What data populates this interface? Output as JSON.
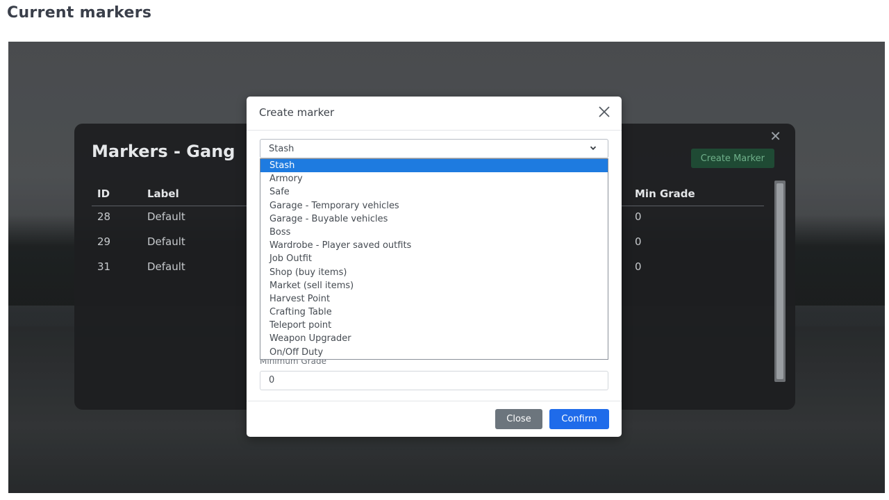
{
  "page": {
    "heading": "Current markers"
  },
  "panel": {
    "title": "Markers - Gang",
    "create_button": "Create Marker",
    "columns": {
      "id": "ID",
      "label": "Label",
      "min_grade": "Min Grade"
    },
    "rows": [
      {
        "id": "28",
        "label": "Default",
        "min_grade": "0"
      },
      {
        "id": "29",
        "label": "Default",
        "min_grade": "0"
      },
      {
        "id": "31",
        "label": "Default",
        "min_grade": "0"
      }
    ]
  },
  "modal": {
    "title": "Create marker",
    "select": {
      "value": "Stash",
      "options": [
        "Stash",
        "Armory",
        "Safe",
        "Garage - Temporary vehicles",
        "Garage - Buyable vehicles",
        "Boss",
        "Wardrobe - Player saved outfits",
        "Job Outfit",
        "Shop (buy items)",
        "Market (sell items)",
        "Harvest Point",
        "Crafting Table",
        "Teleport point",
        "Weapon Upgrader",
        "On/Off Duty"
      ]
    },
    "min_grade_label": "Minimum Grade",
    "min_grade_value": "0",
    "close_button": "Close",
    "confirm_button": "Confirm"
  },
  "colors": {
    "accent_blue": "#1f6bea",
    "selection_blue": "#1e7be0",
    "close_gray": "#6c757d",
    "create_green": "#1f4a34"
  }
}
